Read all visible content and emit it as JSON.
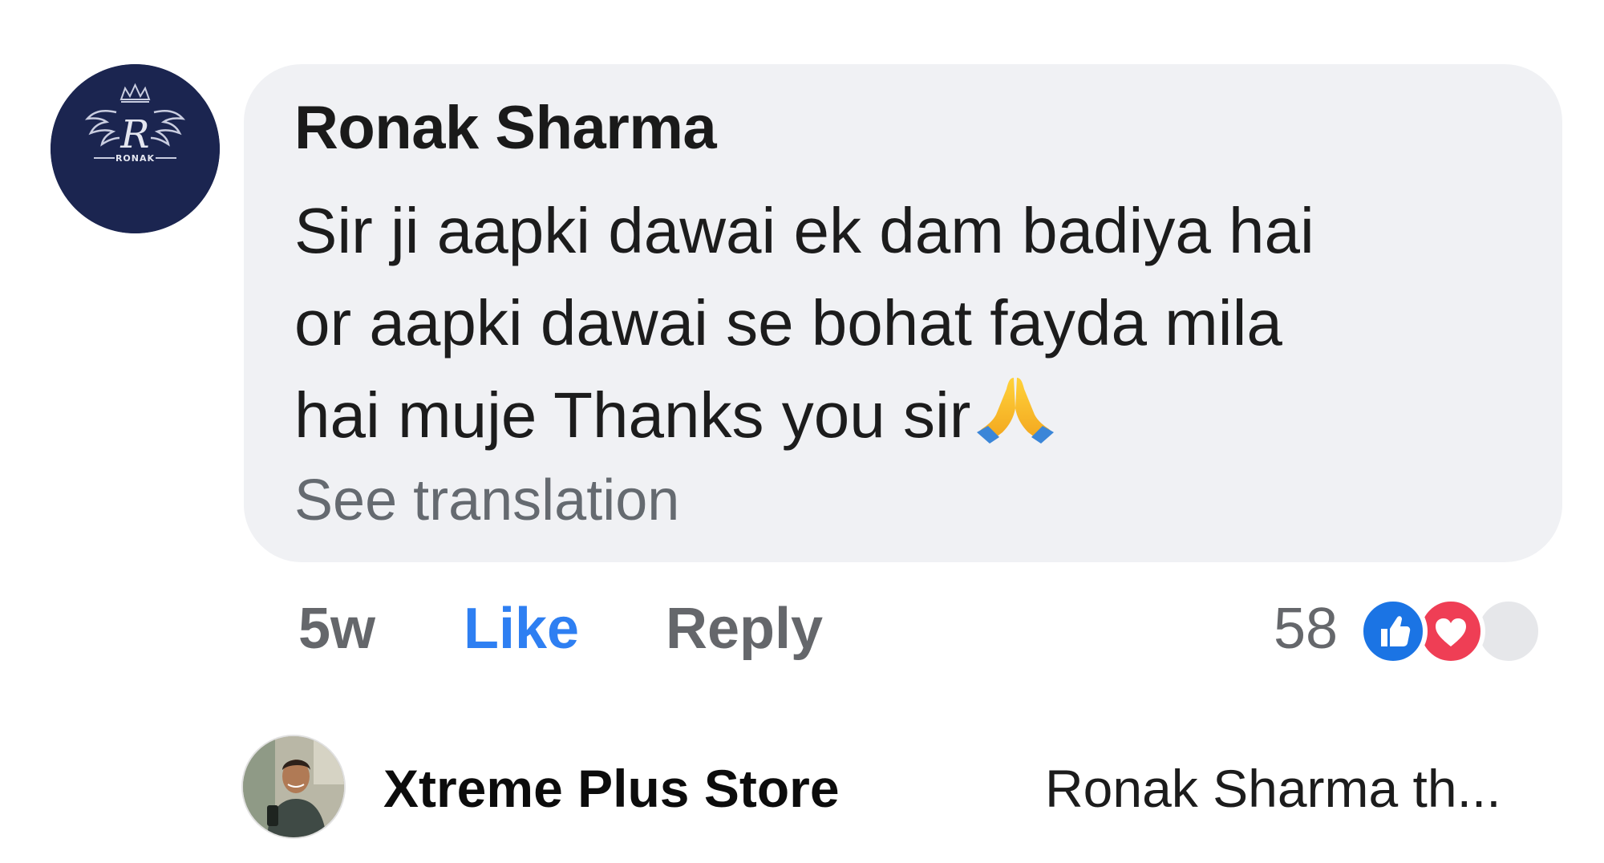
{
  "comment": {
    "author": "Ronak Sharma",
    "avatar_text": "RONAK",
    "avatar_initial": "R",
    "text_line1": "Sir ji aapki dawai ek dam badiya hai",
    "text_line2": "or aapki dawai se bohat fayda mila",
    "text_line3": "hai muje Thanks you sir",
    "emoji_icon": "folded-hands-icon",
    "see_translation": "See translation",
    "time_ago": "5w",
    "like_label": "Like",
    "reply_label": "Reply",
    "reaction_count": "58",
    "reaction_icons": [
      "like-reaction-icon",
      "love-reaction-icon",
      "reaction-placeholder-icon"
    ]
  },
  "reply": {
    "author": "Xtreme Plus Store",
    "preview": "Ronak Sharma th..."
  },
  "colors": {
    "bubble": "#f0f1f4",
    "like_blue": "#2e7ff2",
    "love_red": "#ef3e55",
    "muted_text": "#65676b",
    "avatar_navy": "#1b2550"
  }
}
